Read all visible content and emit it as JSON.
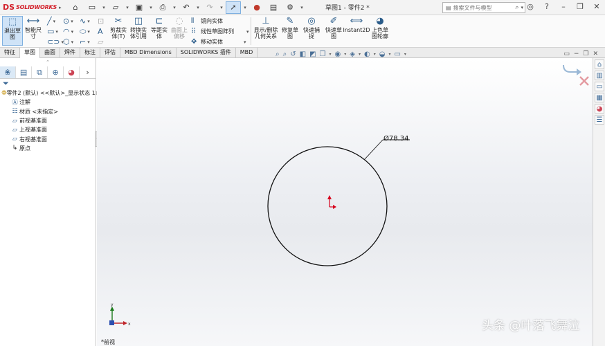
{
  "titlebar": {
    "logo_mark": "DS",
    "logo_text": "SOLIDWORKS",
    "document_title": "草图1 - 零件2 *",
    "search_placeholder": "搜索文件与模型",
    "quick_access": [
      "home-icon",
      "new-file-icon",
      "open-file-icon",
      "save-icon",
      "print-icon",
      "undo-icon",
      "redo-icon",
      "select-icon",
      "traffic-light-icon",
      "file-properties-icon",
      "options-icon"
    ]
  },
  "commands": {
    "exit_sketch": "退出草图",
    "smart_dimension": "智能尺寸",
    "trim": "剪裁实体(T)",
    "convert": "转换实体引用",
    "offset": "等距实体",
    "surface_offset": "曲面上偏移",
    "mirror": "镜向实体",
    "linear_pattern": "线性草图阵列",
    "move": "移动实体",
    "display_relations": "显示/删除几何关系",
    "repair": "修复草图",
    "quick_snaps": "快速捕捉",
    "rapid_sketch": "快速草图",
    "instant2d": "Instant2D",
    "shaded_contours": "上色草图轮廓"
  },
  "tabs": [
    {
      "label": "特征",
      "active": false
    },
    {
      "label": "草图",
      "active": true
    },
    {
      "label": "曲面",
      "active": false
    },
    {
      "label": "焊件",
      "active": false
    },
    {
      "label": "标注",
      "active": false
    },
    {
      "label": "评估",
      "active": false
    },
    {
      "label": "MBD Dimensions",
      "active": false
    },
    {
      "label": "SOLIDWORKS 插件",
      "active": false
    },
    {
      "label": "MBD",
      "active": false
    }
  ],
  "tree": {
    "root": "零件2 (默认) <<默认>_显示状态 1>",
    "items": [
      {
        "label": "注解",
        "icon": "annotation-icon"
      },
      {
        "label": "材质 <未指定>",
        "icon": "material-icon"
      },
      {
        "label": "前视基准面",
        "icon": "plane-icon"
      },
      {
        "label": "上视基准面",
        "icon": "plane-icon"
      },
      {
        "label": "右视基准面",
        "icon": "plane-icon"
      },
      {
        "label": "原点",
        "icon": "origin-icon"
      }
    ]
  },
  "sketch": {
    "dimension_label": "Ø78.34",
    "diameter": 78.34,
    "view_name": "*前视"
  },
  "triad": {
    "x": "x",
    "y": "y"
  },
  "watermark": "头条 @叶落飞舞泣",
  "colors": {
    "accent": "#2a5c8a",
    "logo_red": "#d3202a",
    "origin_red": "#d6001c",
    "highlight": "#cfe3f7"
  }
}
